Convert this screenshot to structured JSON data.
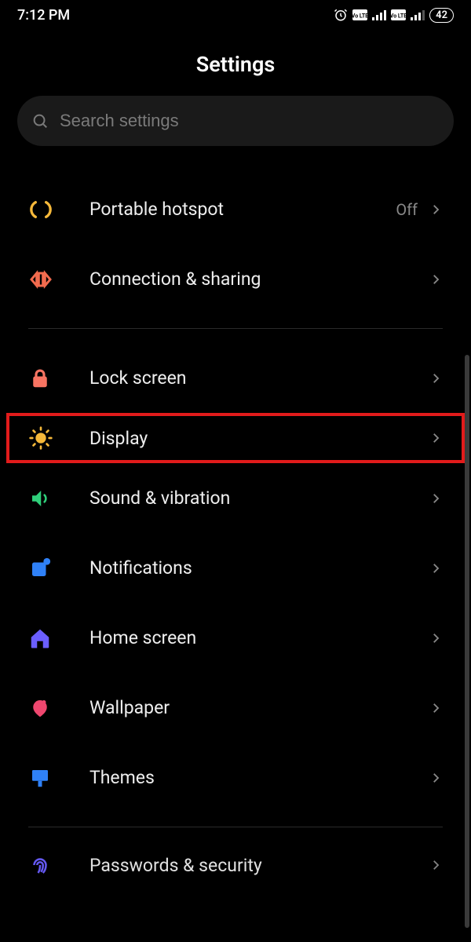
{
  "status": {
    "time": "7:12 PM",
    "battery": "42"
  },
  "page": {
    "title": "Settings"
  },
  "search": {
    "placeholder": "Search settings"
  },
  "items": {
    "hotspot": {
      "label": "Portable hotspot",
      "value": "Off"
    },
    "connection": {
      "label": "Connection & sharing"
    },
    "lock": {
      "label": "Lock screen"
    },
    "display": {
      "label": "Display"
    },
    "sound": {
      "label": "Sound & vibration"
    },
    "notifications": {
      "label": "Notifications"
    },
    "home": {
      "label": "Home screen"
    },
    "wallpaper": {
      "label": "Wallpaper"
    },
    "themes": {
      "label": "Themes"
    },
    "passwords": {
      "label": "Passwords & security"
    }
  }
}
